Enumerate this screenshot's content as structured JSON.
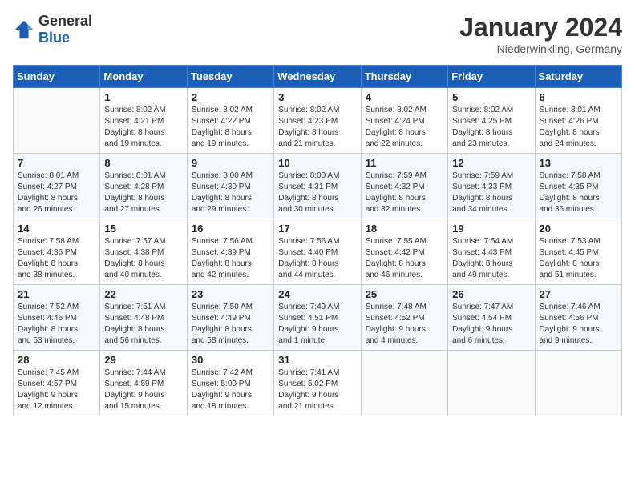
{
  "header": {
    "logo_general": "General",
    "logo_blue": "Blue",
    "title": "January 2024",
    "location": "Niederwinkling, Germany"
  },
  "weekdays": [
    "Sunday",
    "Monday",
    "Tuesday",
    "Wednesday",
    "Thursday",
    "Friday",
    "Saturday"
  ],
  "weeks": [
    [
      {
        "day": "",
        "info": ""
      },
      {
        "day": "1",
        "info": "Sunrise: 8:02 AM\nSunset: 4:21 PM\nDaylight: 8 hours\nand 19 minutes."
      },
      {
        "day": "2",
        "info": "Sunrise: 8:02 AM\nSunset: 4:22 PM\nDaylight: 8 hours\nand 19 minutes."
      },
      {
        "day": "3",
        "info": "Sunrise: 8:02 AM\nSunset: 4:23 PM\nDaylight: 8 hours\nand 21 minutes."
      },
      {
        "day": "4",
        "info": "Sunrise: 8:02 AM\nSunset: 4:24 PM\nDaylight: 8 hours\nand 22 minutes."
      },
      {
        "day": "5",
        "info": "Sunrise: 8:02 AM\nSunset: 4:25 PM\nDaylight: 8 hours\nand 23 minutes."
      },
      {
        "day": "6",
        "info": "Sunrise: 8:01 AM\nSunset: 4:26 PM\nDaylight: 8 hours\nand 24 minutes."
      }
    ],
    [
      {
        "day": "7",
        "info": "Sunrise: 8:01 AM\nSunset: 4:27 PM\nDaylight: 8 hours\nand 26 minutes."
      },
      {
        "day": "8",
        "info": "Sunrise: 8:01 AM\nSunset: 4:28 PM\nDaylight: 8 hours\nand 27 minutes."
      },
      {
        "day": "9",
        "info": "Sunrise: 8:00 AM\nSunset: 4:30 PM\nDaylight: 8 hours\nand 29 minutes."
      },
      {
        "day": "10",
        "info": "Sunrise: 8:00 AM\nSunset: 4:31 PM\nDaylight: 8 hours\nand 30 minutes."
      },
      {
        "day": "11",
        "info": "Sunrise: 7:59 AM\nSunset: 4:32 PM\nDaylight: 8 hours\nand 32 minutes."
      },
      {
        "day": "12",
        "info": "Sunrise: 7:59 AM\nSunset: 4:33 PM\nDaylight: 8 hours\nand 34 minutes."
      },
      {
        "day": "13",
        "info": "Sunrise: 7:58 AM\nSunset: 4:35 PM\nDaylight: 8 hours\nand 36 minutes."
      }
    ],
    [
      {
        "day": "14",
        "info": "Sunrise: 7:58 AM\nSunset: 4:36 PM\nDaylight: 8 hours\nand 38 minutes."
      },
      {
        "day": "15",
        "info": "Sunrise: 7:57 AM\nSunset: 4:38 PM\nDaylight: 8 hours\nand 40 minutes."
      },
      {
        "day": "16",
        "info": "Sunrise: 7:56 AM\nSunset: 4:39 PM\nDaylight: 8 hours\nand 42 minutes."
      },
      {
        "day": "17",
        "info": "Sunrise: 7:56 AM\nSunset: 4:40 PM\nDaylight: 8 hours\nand 44 minutes."
      },
      {
        "day": "18",
        "info": "Sunrise: 7:55 AM\nSunset: 4:42 PM\nDaylight: 8 hours\nand 46 minutes."
      },
      {
        "day": "19",
        "info": "Sunrise: 7:54 AM\nSunset: 4:43 PM\nDaylight: 8 hours\nand 49 minutes."
      },
      {
        "day": "20",
        "info": "Sunrise: 7:53 AM\nSunset: 4:45 PM\nDaylight: 8 hours\nand 51 minutes."
      }
    ],
    [
      {
        "day": "21",
        "info": "Sunrise: 7:52 AM\nSunset: 4:46 PM\nDaylight: 8 hours\nand 53 minutes."
      },
      {
        "day": "22",
        "info": "Sunrise: 7:51 AM\nSunset: 4:48 PM\nDaylight: 8 hours\nand 56 minutes."
      },
      {
        "day": "23",
        "info": "Sunrise: 7:50 AM\nSunset: 4:49 PM\nDaylight: 8 hours\nand 58 minutes."
      },
      {
        "day": "24",
        "info": "Sunrise: 7:49 AM\nSunset: 4:51 PM\nDaylight: 9 hours\nand 1 minute."
      },
      {
        "day": "25",
        "info": "Sunrise: 7:48 AM\nSunset: 4:52 PM\nDaylight: 9 hours\nand 4 minutes."
      },
      {
        "day": "26",
        "info": "Sunrise: 7:47 AM\nSunset: 4:54 PM\nDaylight: 9 hours\nand 6 minutes."
      },
      {
        "day": "27",
        "info": "Sunrise: 7:46 AM\nSunset: 4:56 PM\nDaylight: 9 hours\nand 9 minutes."
      }
    ],
    [
      {
        "day": "28",
        "info": "Sunrise: 7:45 AM\nSunset: 4:57 PM\nDaylight: 9 hours\nand 12 minutes."
      },
      {
        "day": "29",
        "info": "Sunrise: 7:44 AM\nSunset: 4:59 PM\nDaylight: 9 hours\nand 15 minutes."
      },
      {
        "day": "30",
        "info": "Sunrise: 7:42 AM\nSunset: 5:00 PM\nDaylight: 9 hours\nand 18 minutes."
      },
      {
        "day": "31",
        "info": "Sunrise: 7:41 AM\nSunset: 5:02 PM\nDaylight: 9 hours\nand 21 minutes."
      },
      {
        "day": "",
        "info": ""
      },
      {
        "day": "",
        "info": ""
      },
      {
        "day": "",
        "info": ""
      }
    ]
  ]
}
